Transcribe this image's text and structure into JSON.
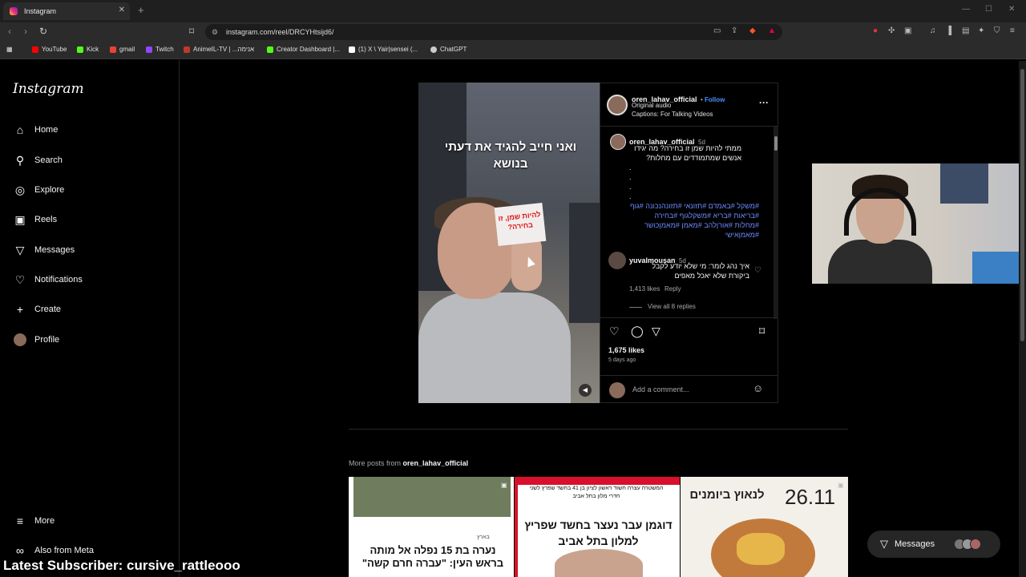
{
  "browser": {
    "tab_title": "Instagram",
    "url": "instagram.com/reel/DRCYHtsijd6/",
    "bookmarks": [
      {
        "label": "YouTube",
        "color": "#ff0000"
      },
      {
        "label": "Kick",
        "color": "#53fc18"
      },
      {
        "label": "gmail",
        "color": "#ea4335"
      },
      {
        "label": "Twitch",
        "color": "#9146ff"
      },
      {
        "label": "AnimeIL-TV | ...אנימה",
        "color": "#c0392b"
      },
      {
        "label": "Creator Dashboard |...",
        "color": "#53fc18"
      },
      {
        "label": "(1) X \\ Yair|sensei (...",
        "color": "#ffffff"
      },
      {
        "label": "ChatGPT",
        "color": "#cccccc"
      }
    ]
  },
  "sidebar": {
    "logo": "Instagram",
    "items": [
      {
        "label": "Home",
        "icon": "home-icon",
        "glyph": "⌂"
      },
      {
        "label": "Search",
        "icon": "search-icon",
        "glyph": "⌕"
      },
      {
        "label": "Explore",
        "icon": "compass-icon",
        "glyph": "◎"
      },
      {
        "label": "Reels",
        "icon": "reels-icon",
        "glyph": "▣"
      },
      {
        "label": "Messages",
        "icon": "messages-icon",
        "glyph": "▽"
      },
      {
        "label": "Notifications",
        "icon": "heart-icon",
        "glyph": "♡"
      },
      {
        "label": "Create",
        "icon": "plus-icon",
        "glyph": "+"
      },
      {
        "label": "Profile",
        "icon": "avatar-icon",
        "glyph": ""
      }
    ],
    "more": "More",
    "also_from_meta": "Also from Meta"
  },
  "post": {
    "video_caption": "ואני חייב להגיד את דעתי בנושא",
    "sign_text": "להיות שמן, זו בחירה?",
    "author": "oren_lahav_official",
    "follow": "Follow",
    "audio": "Original audio",
    "captions": "Captions: For Talking Videos",
    "caption_author": "oren_lahav_official",
    "caption_age": "5d",
    "caption_text": "ממתי להיות שמן זו בחירה? מה יגידו אנשים שמתמודדים עם מחלות?",
    "dots": [
      ".",
      ".",
      ".",
      "."
    ],
    "hashtags": "#משקל #באמדם #תזונאי #תזונהנכונה #גוף #בריאות #בריא #משקלגוף #בחירה #מחלות #אורןלהב #מאמן #מאמןכושר #מאמןאישי",
    "comment_user": "yuvalmousan",
    "comment_age": "5d",
    "comment_text": "איך נהג לומר: מי שלא יודע לקבל ביקורת שלא יאכל מאפים",
    "comment_likes": "1,413 likes",
    "reply": "Reply",
    "view_replies": "View all 8 replies",
    "likes": "1,675 likes",
    "posted": "5 days ago",
    "add_comment_placeholder": "Add a comment..."
  },
  "more_posts": {
    "label": "More posts from",
    "author": "oren_lahav_official",
    "thumbs": [
      {
        "headline": "נערה בת 15 נפלה אל מותה בראש העין: \"עברה חרם קשה\"",
        "section": "בארץ"
      },
      {
        "headline": "דוגמן עבר נעצר בחשד שפריץ למלון בתל אביב",
        "banner": "המשטרה עצרה חשוד ראשון לציון בן 41 בחשד שפרץ לשני חדרי מלון בתל אביב"
      },
      {
        "headline": "לנאוץ ביומנים",
        "date": "26.11"
      }
    ]
  },
  "messages_button": "Messages",
  "overlay": {
    "subscriber": "Latest Subscriber: cursive_rattleooo"
  }
}
